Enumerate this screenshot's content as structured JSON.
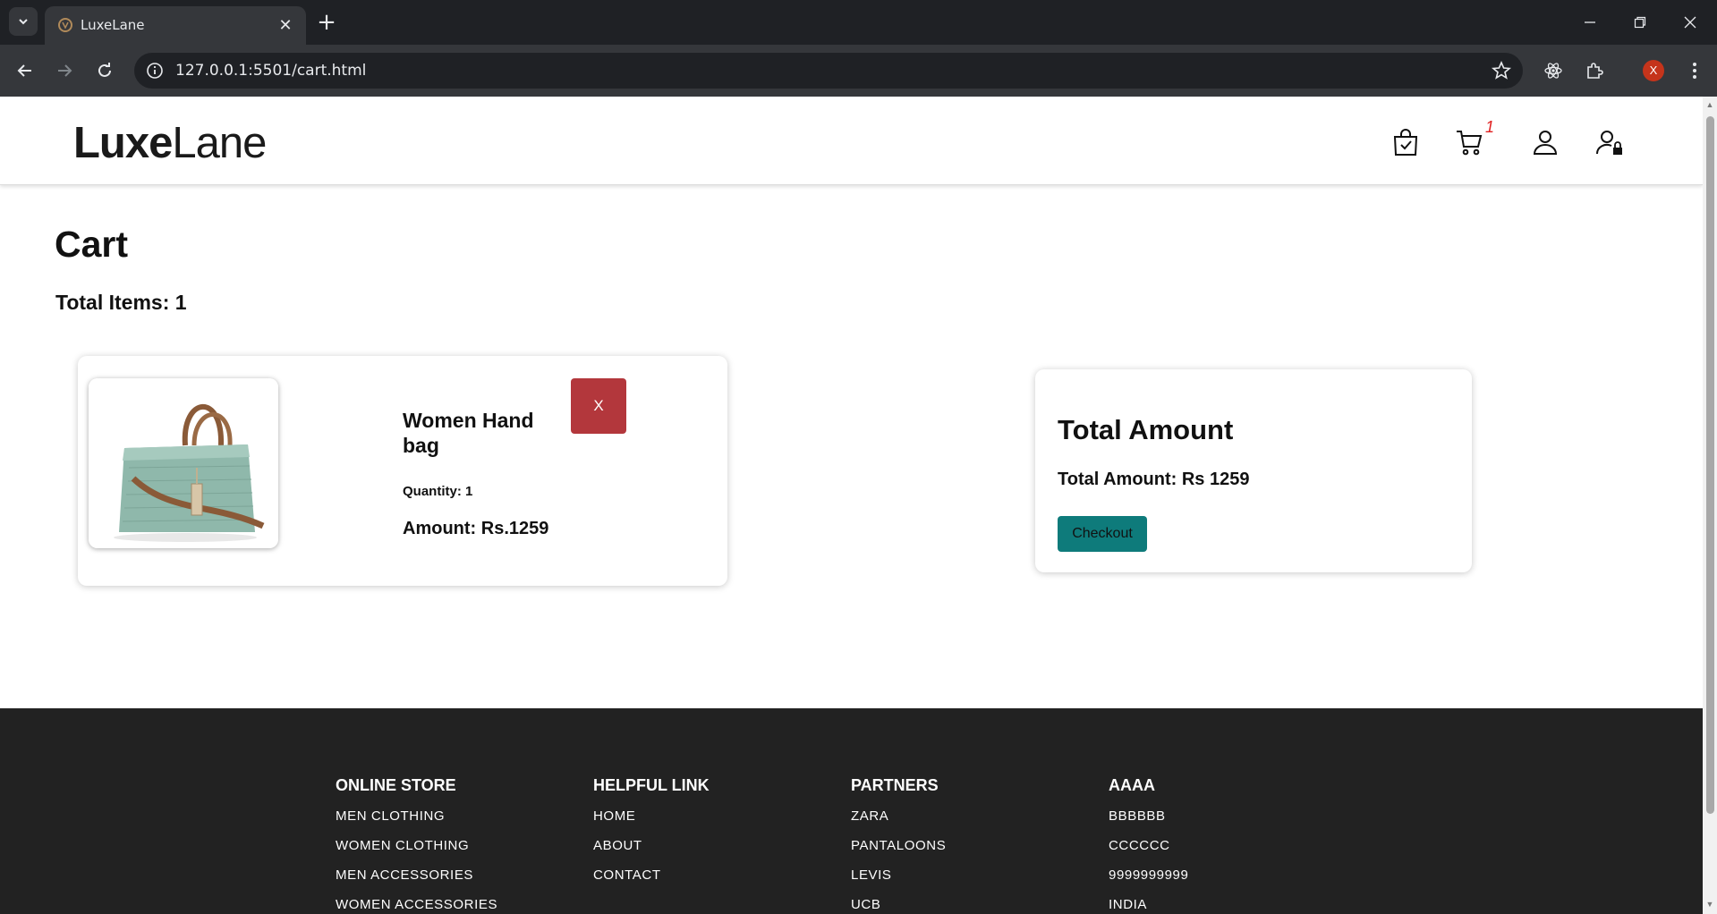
{
  "browser": {
    "tab_title": "LuxeLane",
    "url": "127.0.0.1:5501/cart.html",
    "profile_initial": "X"
  },
  "header": {
    "logo_bold": "Luxe",
    "logo_light": "Lane",
    "cart_count": "1"
  },
  "cart": {
    "title": "Cart",
    "total_items": "Total Items: 1",
    "items": [
      {
        "name": "Women Hand bag",
        "quantity": "Quantity: 1",
        "amount": "Amount: Rs.1259",
        "remove_label": "X"
      }
    ]
  },
  "summary": {
    "title": "Total Amount",
    "total": "Total Amount: Rs 1259",
    "checkout_label": "Checkout"
  },
  "footer": {
    "columns": [
      {
        "heading": "ONLINE STORE",
        "links": [
          "MEN CLOTHING",
          "WOMEN CLOTHING",
          "MEN ACCESSORIES",
          "WOMEN ACCESSORIES"
        ]
      },
      {
        "heading": "HELPFUL LINK",
        "links": [
          "HOME",
          "ABOUT",
          "CONTACT"
        ]
      },
      {
        "heading": "PARTNERS",
        "links": [
          "ZARA",
          "PANTALOONS",
          "LEVIS",
          "UCB"
        ]
      },
      {
        "heading": "AAAA",
        "links": [
          "BBBBBB",
          "CCCCCC",
          "9999999999",
          "INDIA"
        ]
      }
    ]
  },
  "colors": {
    "remove_button": "#b3373c",
    "checkout_button": "#0e7b7b",
    "footer_bg": "#222222",
    "cart_badge": "#e02020"
  }
}
